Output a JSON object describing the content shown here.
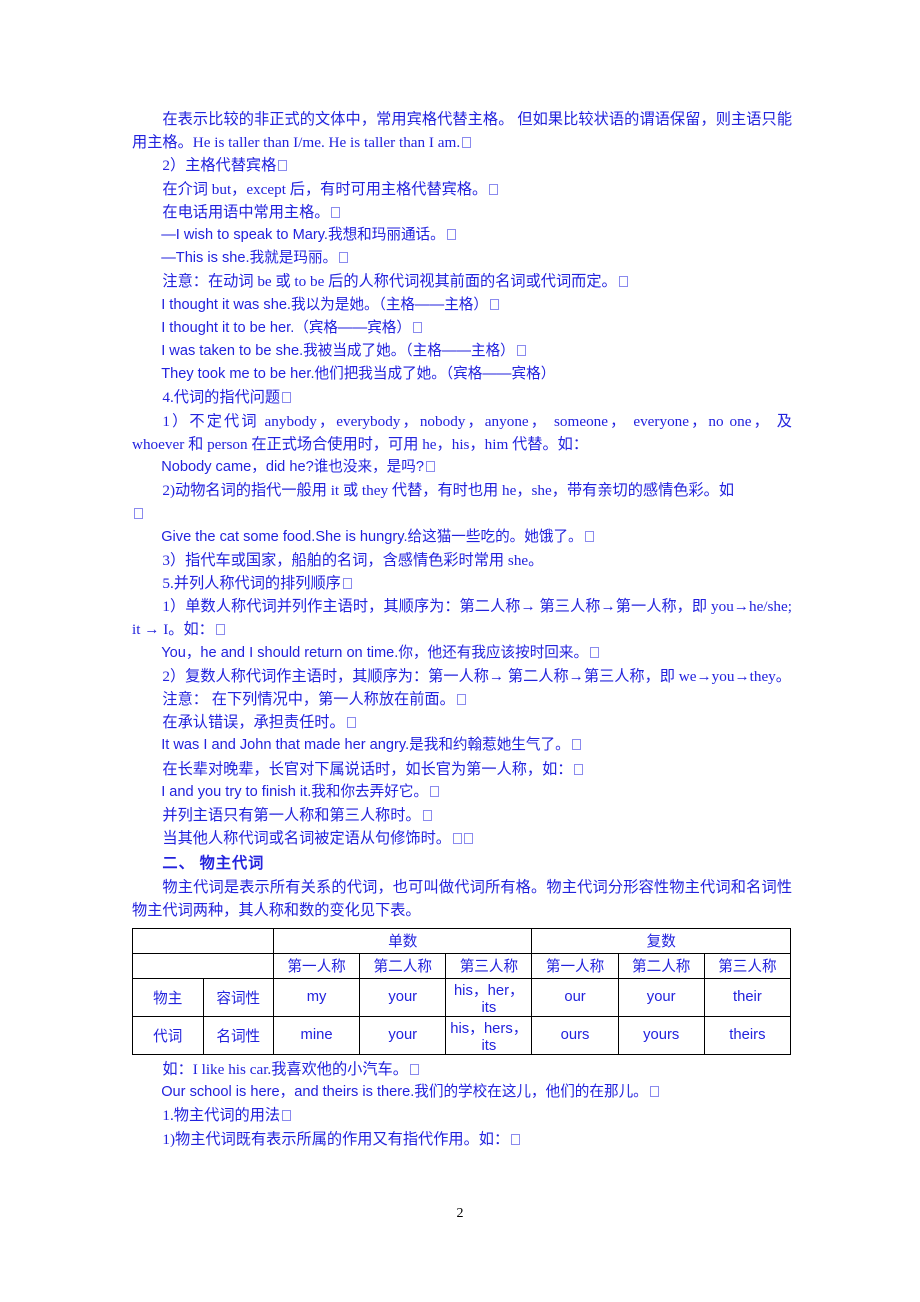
{
  "document": {
    "page_number": "2",
    "text_color": "#2222DD",
    "page_number_color": "#000000"
  },
  "paragraphs": {
    "p1": "在表示比较的非正式的文体中，常用宾格代替主格。 但如果比较状语的谓语保留，则主语只能用主格。He is taller than I/me. He is taller than I am.",
    "p2": "2）主格代替宾格",
    "p3": "在介词 but，except 后，有时可用主格代替宾格。",
    "p4": "在电话用语中常用主格。",
    "p5": "—I wish to speak to Mary.我想和玛丽通话。",
    "p6": "—This is she.我就是玛丽。",
    "p7": "注意：在动词 be 或 to be 后的人称代词视其前面的名词或代词而定。",
    "p8": "I thought it was she.我以为是她。（主格——主格）",
    "p9": "I thought it to be her.（宾格——宾格）",
    "p10": "I was taken to be she.我被当成了她。（主格——主格）",
    "p11": "They took me to be her.他们把我当成了她。（宾格——宾格）",
    "p12": "4.代词的指代问题",
    "p13": "1）不定代词 anybody，everybody，nobody，anyone， someone， everyone，no one， 及 whoever 和 person 在正式场合使用时，可用 he，his，him 代替。如：",
    "p14": "Nobody came，did he?谁也没来，是吗?",
    "p15": "2)动物名词的指代一般用 it 或 they 代替，有时也用 he，she，带有亲切的感情色彩。如",
    "p16": "Give the cat some food.She is hungry.给这猫一些吃的。她饿了。",
    "p17": "3）指代车或国家，船舶的名词，含感情色彩时常用 she。",
    "p18": "5.并列人称代词的排列顺序",
    "p19": "1）单数人称代词并列作主语时，其顺序为：第二人称→ 第三人称→第一人称，即 you→he/she; it → I。如：",
    "p20": "You，he and I should return on time.你，他还有我应该按时回来。",
    "p21": "2）复数人称代词作主语时，其顺序为：第一人称→ 第二人称→第三人称，即 we→you→they。",
    "p22": "注意： 在下列情况中，第一人称放在前面。",
    "p23": "在承认错误，承担责任时。",
    "p24": "It was I and John that made her angry.是我和约翰惹她生气了。",
    "p25": "在长辈对晚辈，长官对下属说话时，如长官为第一人称，如：",
    "p26": "I and you try to finish it.我和你去弄好它。",
    "p27": "并列主语只有第一人称和第三人称时。",
    "p28": "当其他人称代词或名词被定语从句修饰时。",
    "heading_possessive": "二、 物主代词",
    "p29": "物主代词是表示所有关系的代词，也可叫做代词所有格。物主代词分形容性物主代词和名词性物主代词两种，其人称和数的变化见下表。",
    "p30": "如：I like his car.我喜欢他的小汽车。",
    "p31": "Our school is here，and theirs is there.我们的学校在这儿，他们的在那儿。",
    "p32": "1.物主代词的用法",
    "p33": "1)物主代词既有表示所属的作用又有指代作用。如："
  },
  "table": {
    "group_headers": {
      "empty": "",
      "singular": "单数",
      "plural": "复数"
    },
    "person_headers": {
      "sg1": "第一人称",
      "sg2": "第二人称",
      "sg3": "第三人称",
      "pl1": "第一人称",
      "pl2": "第二人称",
      "pl3": "第三人称"
    },
    "row_label_top": "物主",
    "row_label_bottom": "代词",
    "rows": [
      {
        "type": "容词性",
        "sg1": "my",
        "sg2": "your",
        "sg3": "his，her，its",
        "pl1": "our",
        "pl2": "your",
        "pl3": "their"
      },
      {
        "type": "名词性",
        "sg1": "mine",
        "sg2": "your",
        "sg3": "his，hers，its",
        "pl1": "ours",
        "pl2": "yours",
        "pl3": "theirs"
      }
    ]
  }
}
